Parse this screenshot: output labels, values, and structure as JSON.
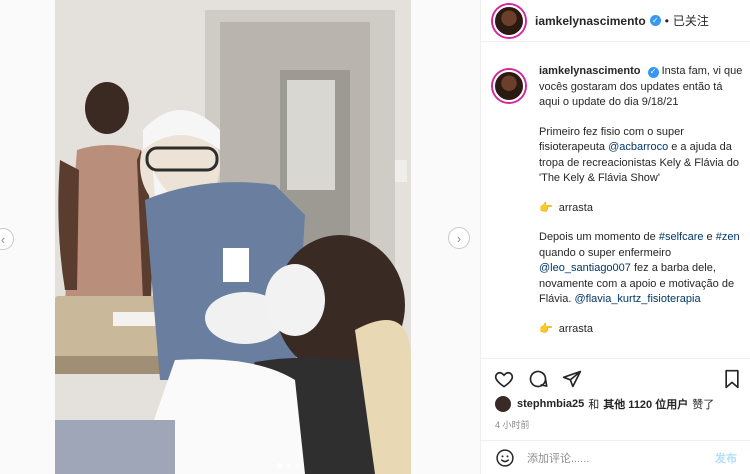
{
  "post": {
    "username": "iamkelynascimento",
    "follow_state": "已关注",
    "separator": "•",
    "caption": {
      "p1": "Insta fam, vi que vocês gostaram dos updates então tá aqui o update do dia 9/18/21",
      "p2_a": "Primeiro fez fisio com o super fisioterapeuta ",
      "p2_tag": "@acbarroco",
      "p2_b": " e a ajuda da tropa de recreacionistas Kely & Flávia do 'The Kely & Flávia Show'",
      "p3": "arrasta",
      "p4_a": "Depois um momento de ",
      "p4_tag1": "#selfcare",
      "p4_b": " e ",
      "p4_tag2": "#zen",
      "p4_c": " quando o super enfermeiro ",
      "p4_tag3": "@leo_santiago007",
      "p4_d": " fez a barba dele, novamente com a apoio e motivação de Flávia. ",
      "p4_tag4": "@flavia_kurtz_fisioterapia",
      "p5": "arrasta"
    },
    "likes": {
      "liker": "stephmbia25",
      "and": "和",
      "others": "其他 1120 位用户",
      "liked": "赞了"
    },
    "time": "4 小时前",
    "comment_placeholder": "添加评论......",
    "post_label": "发布"
  },
  "icons": {
    "prev": "chevron-left-icon",
    "next": "chevron-right-icon",
    "like": "heart-icon",
    "comment": "comment-icon",
    "share": "share-icon",
    "save": "bookmark-icon",
    "emoji": "smiley-icon",
    "verified": "verified-badge-icon",
    "point": "pointing-hand-icon"
  },
  "colors": {
    "link": "#00376b",
    "verified": "#3897f0",
    "muted": "#8e8e8e",
    "post_disabled": "#b2dffc"
  }
}
